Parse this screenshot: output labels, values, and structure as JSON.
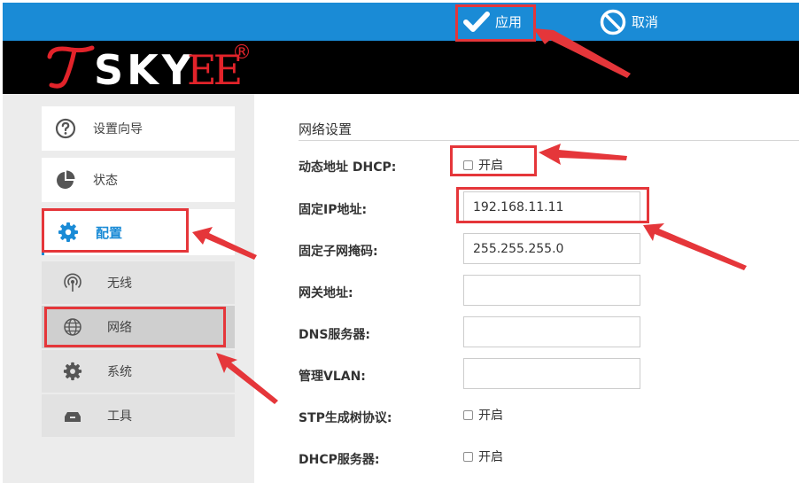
{
  "toolbar": {
    "apply_label": "应用",
    "cancel_label": "取消"
  },
  "logo": {
    "brand": "SKY",
    "brand_suffix": "EE",
    "registered_mark": "®"
  },
  "sidebar": {
    "items": [
      {
        "label": "设置向导",
        "icon": "question-circle-icon"
      },
      {
        "label": "状态",
        "icon": "pie-chart-icon"
      },
      {
        "label": "配置",
        "icon": "gear-icon",
        "active": true
      }
    ],
    "sub_items": [
      {
        "label": "无线",
        "icon": "wireless-icon"
      },
      {
        "label": "网络",
        "icon": "globe-icon",
        "selected": true
      },
      {
        "label": "系统",
        "icon": "gear-icon"
      },
      {
        "label": "工具",
        "icon": "toolbox-icon"
      }
    ]
  },
  "main": {
    "section_title": "网络设置",
    "fields": {
      "dhcp_label": "动态地址 DHCP:",
      "dhcp_option": "开启",
      "dhcp_checked": false,
      "ip_label": "固定IP地址:",
      "ip_value": "192.168.11.11",
      "mask_label": "固定子网掩码:",
      "mask_value": "255.255.255.0",
      "gateway_label": "网关地址:",
      "gateway_value": "",
      "dns_label": "DNS服务器:",
      "dns_value": "",
      "vlan_label": "管理VLAN:",
      "vlan_value": "",
      "stp_label": "STP生成树协议:",
      "stp_option": "开启",
      "stp_checked": false,
      "dhcp_server_label": "DHCP服务器:",
      "dhcp_server_option": "开启",
      "dhcp_server_checked": false
    }
  },
  "colors": {
    "topbar": "#1a8bd6",
    "accent": "#1a8bd6",
    "highlight": "#e5363a",
    "logo_red": "#e2232a"
  }
}
